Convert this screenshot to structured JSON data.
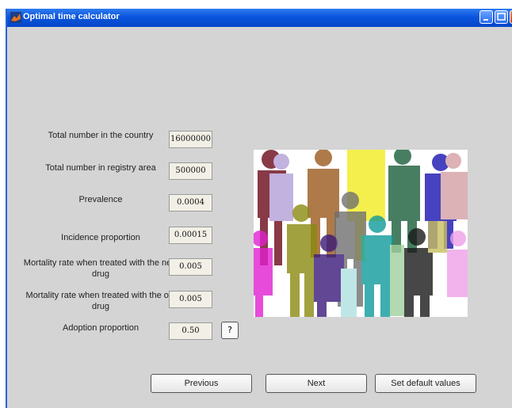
{
  "window": {
    "title": "Optimal time calculator"
  },
  "form": {
    "fields": [
      {
        "label": "Total number in the country",
        "value": "16000000"
      },
      {
        "label": "Total number in registry area",
        "value": "500000"
      },
      {
        "label": "Prevalence",
        "value": "0.0004"
      },
      {
        "label": "Incidence proportion",
        "value": "0.00015"
      },
      {
        "label": "Mortality rate when treated with the new drug",
        "value": "0.005"
      },
      {
        "label": "Mortality rate when treated with the old drug",
        "value": "0.005"
      },
      {
        "label": "Adoption proportion",
        "value": "0.50"
      }
    ],
    "help_label": "?"
  },
  "image": {
    "icon": "crowd-of-people-illustration"
  },
  "buttons": {
    "previous": "Previous",
    "next": "Next",
    "defaults": "Set default values"
  },
  "icons": {
    "minimize": "minimize-icon",
    "maximize": "maximize-icon",
    "close": "close-icon",
    "app": "matlab-app-icon"
  }
}
